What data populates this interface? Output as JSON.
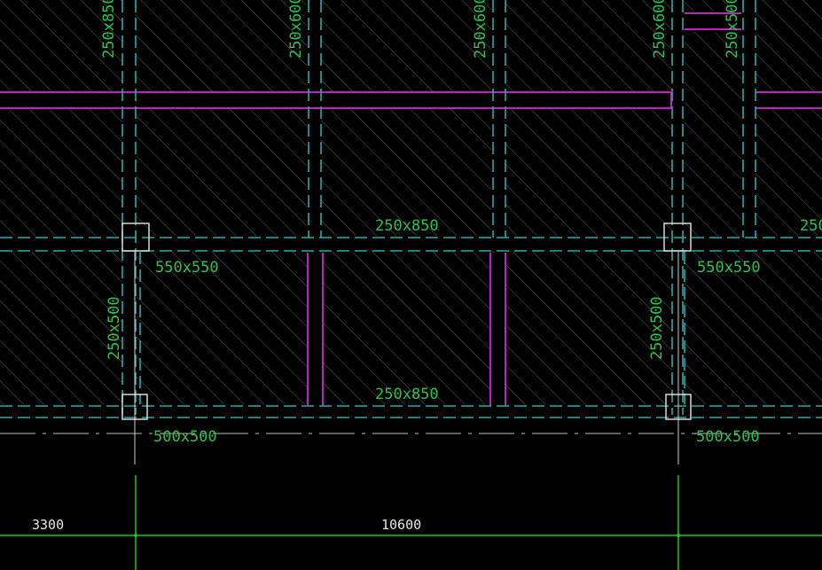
{
  "beam_labels": {
    "vertical_top": [
      "250x850",
      "250x600",
      "250x600",
      "250x600",
      "250x500"
    ],
    "horizontal_mid": "250x850",
    "horizontal_mid_right": "250",
    "horizontal_bottom": "250x850",
    "vertical_left_mid": "250x500",
    "vertical_right_mid": "250x500"
  },
  "column_labels": {
    "left_upper": "550x550",
    "right_upper": "550x550",
    "left_lower": "500x500",
    "right_lower": "500x500"
  },
  "dimensions": {
    "left": "3300",
    "middle": "10600"
  },
  "colors": {
    "background": "#000000",
    "beam": "#1fb0b0",
    "secondary_beam": "#c21fc2",
    "label_green": "#2ec24a",
    "dimension_green": "#18c818"
  }
}
